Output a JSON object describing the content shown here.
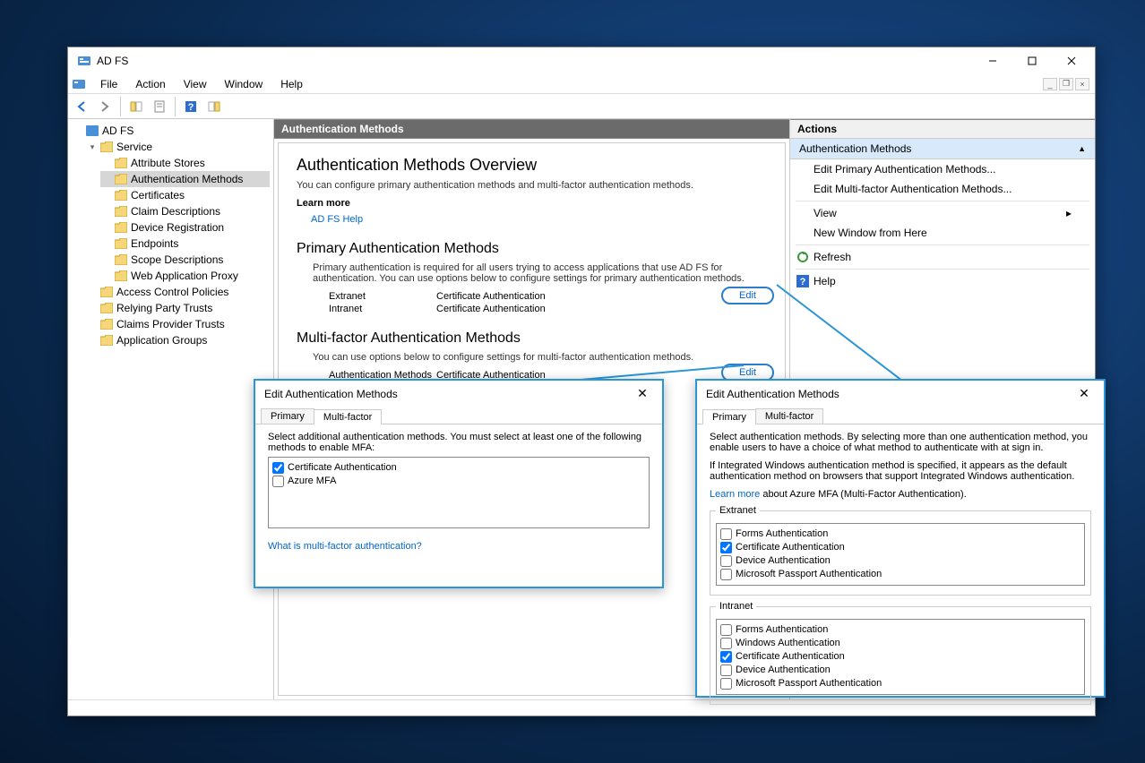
{
  "window": {
    "title": "AD FS"
  },
  "menus": [
    "File",
    "Action",
    "View",
    "Window",
    "Help"
  ],
  "tree": {
    "root": "AD FS",
    "service": "Service",
    "service_children": [
      "Attribute Stores",
      "Authentication Methods",
      "Certificates",
      "Claim Descriptions",
      "Device Registration",
      "Endpoints",
      "Scope Descriptions",
      "Web Application Proxy"
    ],
    "siblings": [
      "Access Control Policies",
      "Relying Party Trusts",
      "Claims Provider Trusts",
      "Application Groups"
    ],
    "selected": "Authentication Methods"
  },
  "center": {
    "header": "Authentication Methods",
    "overview_title": "Authentication Methods Overview",
    "overview_desc": "You can configure primary authentication methods and multi-factor authentication methods.",
    "learn_more_label": "Learn more",
    "help_link": "AD FS Help",
    "primary_title": "Primary Authentication Methods",
    "primary_desc": "Primary authentication is required for all users trying to access applications that use AD FS for authentication. You can use options below to configure settings for primary authentication methods.",
    "primary_rows": [
      {
        "k": "Extranet",
        "v": "Certificate Authentication"
      },
      {
        "k": "Intranet",
        "v": "Certificate Authentication"
      }
    ],
    "mfa_title": "Multi-factor Authentication Methods",
    "mfa_desc": "You can use options below to configure settings for multi-factor authentication methods.",
    "mfa_rows": [
      {
        "k": "Authentication Methods",
        "v": "Certificate Authentication"
      }
    ],
    "edit_label": "Edit"
  },
  "actions": {
    "header": "Actions",
    "section": "Authentication Methods",
    "items": [
      "Edit Primary Authentication Methods...",
      "Edit Multi-factor Authentication Methods...",
      "View",
      "New Window from Here",
      "Refresh",
      "Help"
    ]
  },
  "dialog_mfa": {
    "title": "Edit Authentication Methods",
    "tab_primary": "Primary",
    "tab_mfa": "Multi-factor",
    "desc": "Select additional authentication methods. You must select at least one of the following methods to enable MFA:",
    "options": [
      {
        "label": "Certificate Authentication",
        "checked": true
      },
      {
        "label": "Azure MFA",
        "checked": false
      }
    ],
    "link": "What is multi-factor authentication?"
  },
  "dialog_primary": {
    "title": "Edit Authentication Methods",
    "tab_primary": "Primary",
    "tab_mfa": "Multi-factor",
    "desc1": "Select authentication methods. By selecting more than one authentication method, you enable users to have a choice of what method to authenticate with at sign in.",
    "desc2": "If Integrated Windows authentication method is specified, it appears as the default authentication method on browsers that support Integrated Windows authentication.",
    "learn_link": "Learn more",
    "learn_suffix": " about Azure MFA (Multi-Factor Authentication).",
    "extranet_label": "Extranet",
    "extranet_options": [
      {
        "label": "Forms Authentication",
        "checked": false
      },
      {
        "label": "Certificate Authentication",
        "checked": true
      },
      {
        "label": "Device Authentication",
        "checked": false
      },
      {
        "label": "Microsoft Passport Authentication",
        "checked": false
      }
    ],
    "intranet_label": "Intranet",
    "intranet_options": [
      {
        "label": "Forms Authentication",
        "checked": false
      },
      {
        "label": "Windows Authentication",
        "checked": false
      },
      {
        "label": "Certificate Authentication",
        "checked": true
      },
      {
        "label": "Device Authentication",
        "checked": false
      },
      {
        "label": "Microsoft Passport Authentication",
        "checked": false
      }
    ]
  }
}
